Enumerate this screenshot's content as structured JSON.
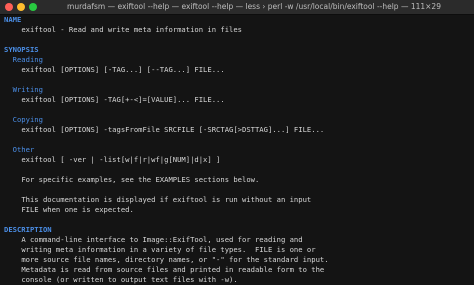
{
  "window": {
    "title": "murdafsm — exiftool --help — exiftool --help — less › perl -w /usr/local/bin/exiftool --help — 111×29"
  },
  "man": {
    "name_heading": "NAME",
    "name_line": "exiftool - Read and write meta information in files",
    "synopsis_heading": "SYNOPSIS",
    "reading_heading": "Reading",
    "reading_cmd": "exiftool [OPTIONS] [-TAG...] [--TAG...] FILE...",
    "writing_heading": "Writing",
    "writing_cmd": "exiftool [OPTIONS] -TAG[+-<]=[VALUE]... FILE...",
    "copying_heading": "Copying",
    "copying_cmd": "exiftool [OPTIONS] -tagsFromFile SRCFILE [-SRCTAG[>DSTTAG]...] FILE...",
    "other_heading": "Other",
    "other_cmd": "exiftool [ -ver | -list[w|f|r|wf|g[NUM]|d|x] ]",
    "examples_note": "For specific examples, see the EXAMPLES sections below.",
    "doc_note_1": "This documentation is displayed if exiftool is run without an input",
    "doc_note_2": "FILE when one is expected.",
    "description_heading": "DESCRIPTION",
    "desc_1": "A command-line interface to Image::ExifTool, used for reading and",
    "desc_2": "writing meta information in a variety of file types.  FILE is one or",
    "desc_3": "more source file names, directory names, or \"-\" for the standard input.",
    "desc_4": "Metadata is read from source files and printed in readable form to the",
    "desc_5": "console (or written to output text files with -w)."
  },
  "pager_prompt": ":"
}
